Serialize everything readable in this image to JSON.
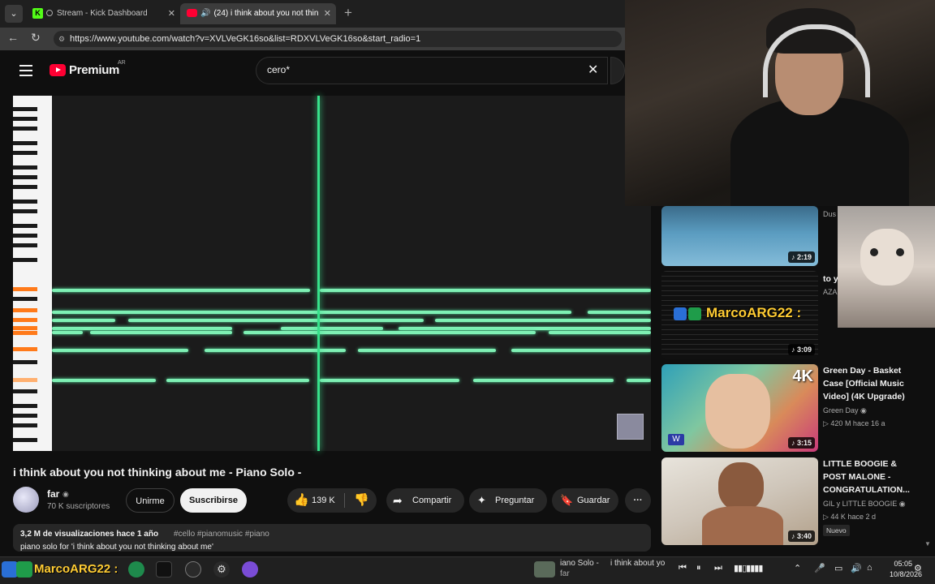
{
  "browser": {
    "tabs": [
      {
        "title": "Stream - Kick Dashboard",
        "favicon": "kick-icon"
      },
      {
        "title": "(24) i think about you not thin",
        "favicon": "youtube-icon"
      }
    ],
    "url": "https://www.youtube.com/watch?v=XVLVeGK16so&list=RDXVLVeGK16so&start_radio=1"
  },
  "header": {
    "logo": "Premium",
    "region": "AR",
    "search_value": "cero*"
  },
  "video": {
    "title": "i think about you not thinking about me - Piano Solo -",
    "channel": "far",
    "subscribers": "70 K suscriptores",
    "join_label": "Unirme",
    "subscribe_label": "Suscribirse",
    "likes": "139 K",
    "share_label": "Compartir",
    "ask_label": "Preguntar",
    "save_label": "Guardar",
    "views_date": "3,2 M de visualizaciones  hace 1 año",
    "hashtags": "#cello #pianomusic #piano",
    "description_line": "piano solo for 'i think about you not thinking about me'"
  },
  "sidebar": [
    {
      "title_partial": "Dus",
      "duration": "2:19"
    },
    {
      "title_partial": "to y",
      "channel_partial": "AZA",
      "duration": "3:09"
    },
    {
      "title": "Green Day - Basket Case [Official Music Video] (4K Upgrade)",
      "channel": "Green Day",
      "meta": "420 M  hace 16 a",
      "duration": "3:15",
      "badge": "4K"
    },
    {
      "title": "LITTLE BOOGIE & POST MALONE - CONGRATULATION...",
      "channel": "GIL y LITTLE BOOGIE",
      "meta": "44 K  hace 2 d",
      "duration": "3:40",
      "new": "Nuevo"
    }
  ],
  "overlay_tag": "MarcoARG22 :",
  "taskbar": {
    "media_title_1": "iano Solo -",
    "media_title_2": "i think about yo",
    "media_channel": "far",
    "time": "05:05",
    "date": "10/8/2026",
    "tag": "MarcoARG22 :"
  },
  "colors": {
    "accent_red": "#ff0033",
    "note_green": "#7ef0b4",
    "playhead_green": "#37e08a",
    "kick_green": "#53fc18"
  }
}
